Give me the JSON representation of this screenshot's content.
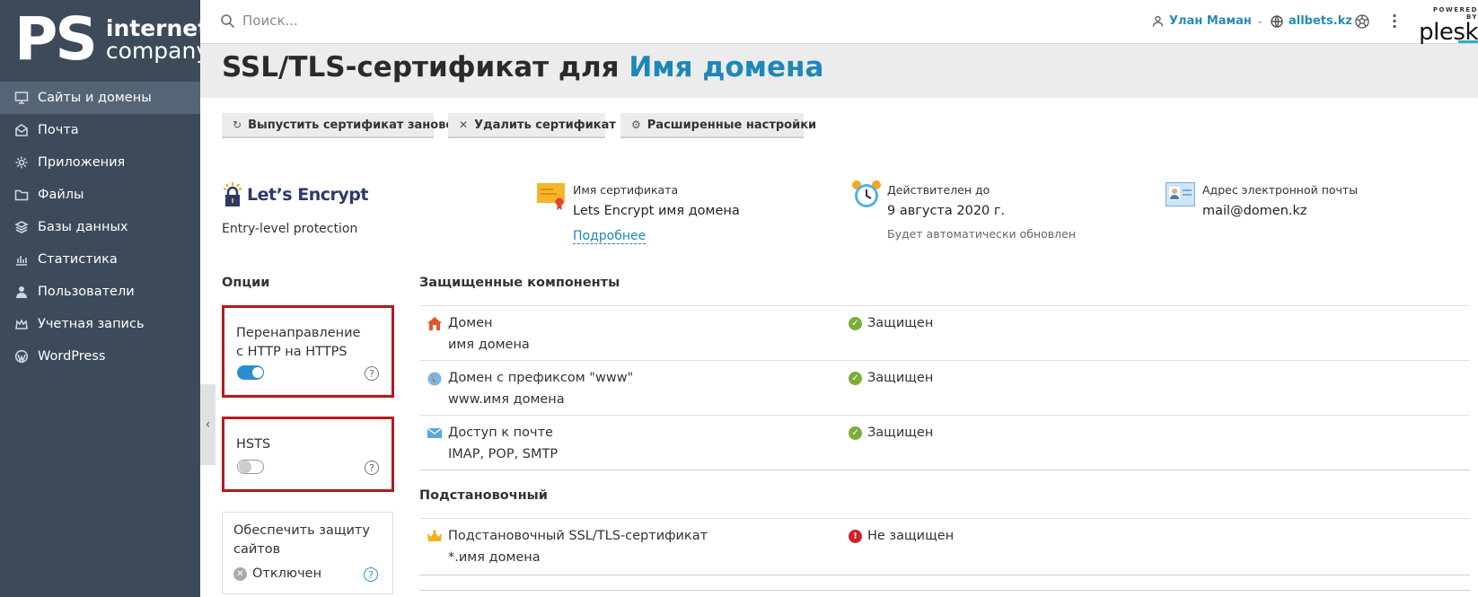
{
  "sidebar": {
    "logo_letters": "PS",
    "logo_line1": "internet",
    "logo_line2": "company",
    "items": [
      {
        "label": "Сайты и домены",
        "icon": "monitor-icon"
      },
      {
        "label": "Почта",
        "icon": "mail-icon"
      },
      {
        "label": "Приложения",
        "icon": "gear-icon"
      },
      {
        "label": "Файлы",
        "icon": "folder-icon"
      },
      {
        "label": "Базы данных",
        "icon": "database-icon"
      },
      {
        "label": "Статистика",
        "icon": "bar-chart-icon"
      },
      {
        "label": "Пользователи",
        "icon": "user-icon"
      },
      {
        "label": "Учетная запись",
        "icon": "account-icon"
      },
      {
        "label": "WordPress",
        "icon": "wordpress-icon"
      }
    ]
  },
  "header": {
    "search_placeholder": "Поиск...",
    "user_name": "Улан Маман",
    "domain": "allbets.kz",
    "powered_by": "POWERED BY",
    "brand": "plesk"
  },
  "page": {
    "title_prefix": "SSL/TLS-сертификат для",
    "title_domain": "Имя домена"
  },
  "toolbar": {
    "reissue": "Выпустить сертификат заново",
    "delete": "Удалить сертификат",
    "advanced": "Расширенные настройки"
  },
  "certificate": {
    "issuer": "Let’s Encrypt",
    "protection_level": "Entry-level protection",
    "name_label": "Имя сертификата",
    "name_value": "Lets Encrypt имя домена",
    "more_link": "Подробнее",
    "valid_label": "Действителен до",
    "valid_value": "9 августа 2020 г.",
    "valid_note": "Будет автоматически обновлен",
    "email_label": "Адрес электронной почты",
    "email_value": "mail@domen.kz"
  },
  "options": {
    "heading": "Опции",
    "redirect_label": "Перенаправление с HTTP на HTTPS",
    "redirect_on": true,
    "hsts_label": "HSTS",
    "hsts_on": false,
    "protect_label": "Обеспечить защиту сайтов",
    "protect_status": "Отключен"
  },
  "components": {
    "heading": "Защищенные компоненты",
    "rows": [
      {
        "name": "Домен",
        "detail": "имя домена",
        "status": "Защищен",
        "icon": "home-icon"
      },
      {
        "name": "Домен с префиксом \"www\"",
        "detail": "www.имя домена",
        "status": "Защищен",
        "icon": "globe-icon"
      },
      {
        "name": "Доступ к почте",
        "detail": "IMAP, POP, SMTP",
        "status": "Защищен",
        "icon": "envelope-icon"
      }
    ],
    "wildcard_heading": "Подстановочный",
    "wildcard": {
      "name": "Подстановочный SSL/TLS-сертификат",
      "detail": "*.имя домена",
      "status": "Не защищен",
      "icon": "crown-icon"
    }
  },
  "colors": {
    "sidebar_bg": "#3d4a59",
    "accent": "#1d87b9",
    "ok": "#7cad3a",
    "bad": "#d0222a",
    "highlight_box": "#b41c1c"
  }
}
